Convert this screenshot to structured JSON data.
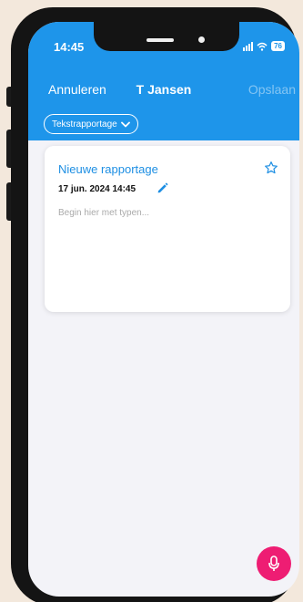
{
  "status_bar": {
    "time": "14:45",
    "battery": "76"
  },
  "nav": {
    "cancel_label": "Annuleren",
    "title": "T Jansen",
    "save_label": "Opslaan"
  },
  "report_type": {
    "selected": "Tekstrapportage"
  },
  "report": {
    "title": "Nieuwe rapportage",
    "datetime": "17 jun. 2024 14:45",
    "placeholder": "Begin hier met typen..."
  },
  "icons": {
    "favorite": "star-icon",
    "edit_date": "pencil-icon",
    "dropdown": "chevron-down-icon",
    "voice": "microphone-icon"
  },
  "colors": {
    "header": "#1e95ea",
    "accent": "#1e8fe3",
    "mic_button": "#ee1d73",
    "background": "#f3f3f8"
  }
}
